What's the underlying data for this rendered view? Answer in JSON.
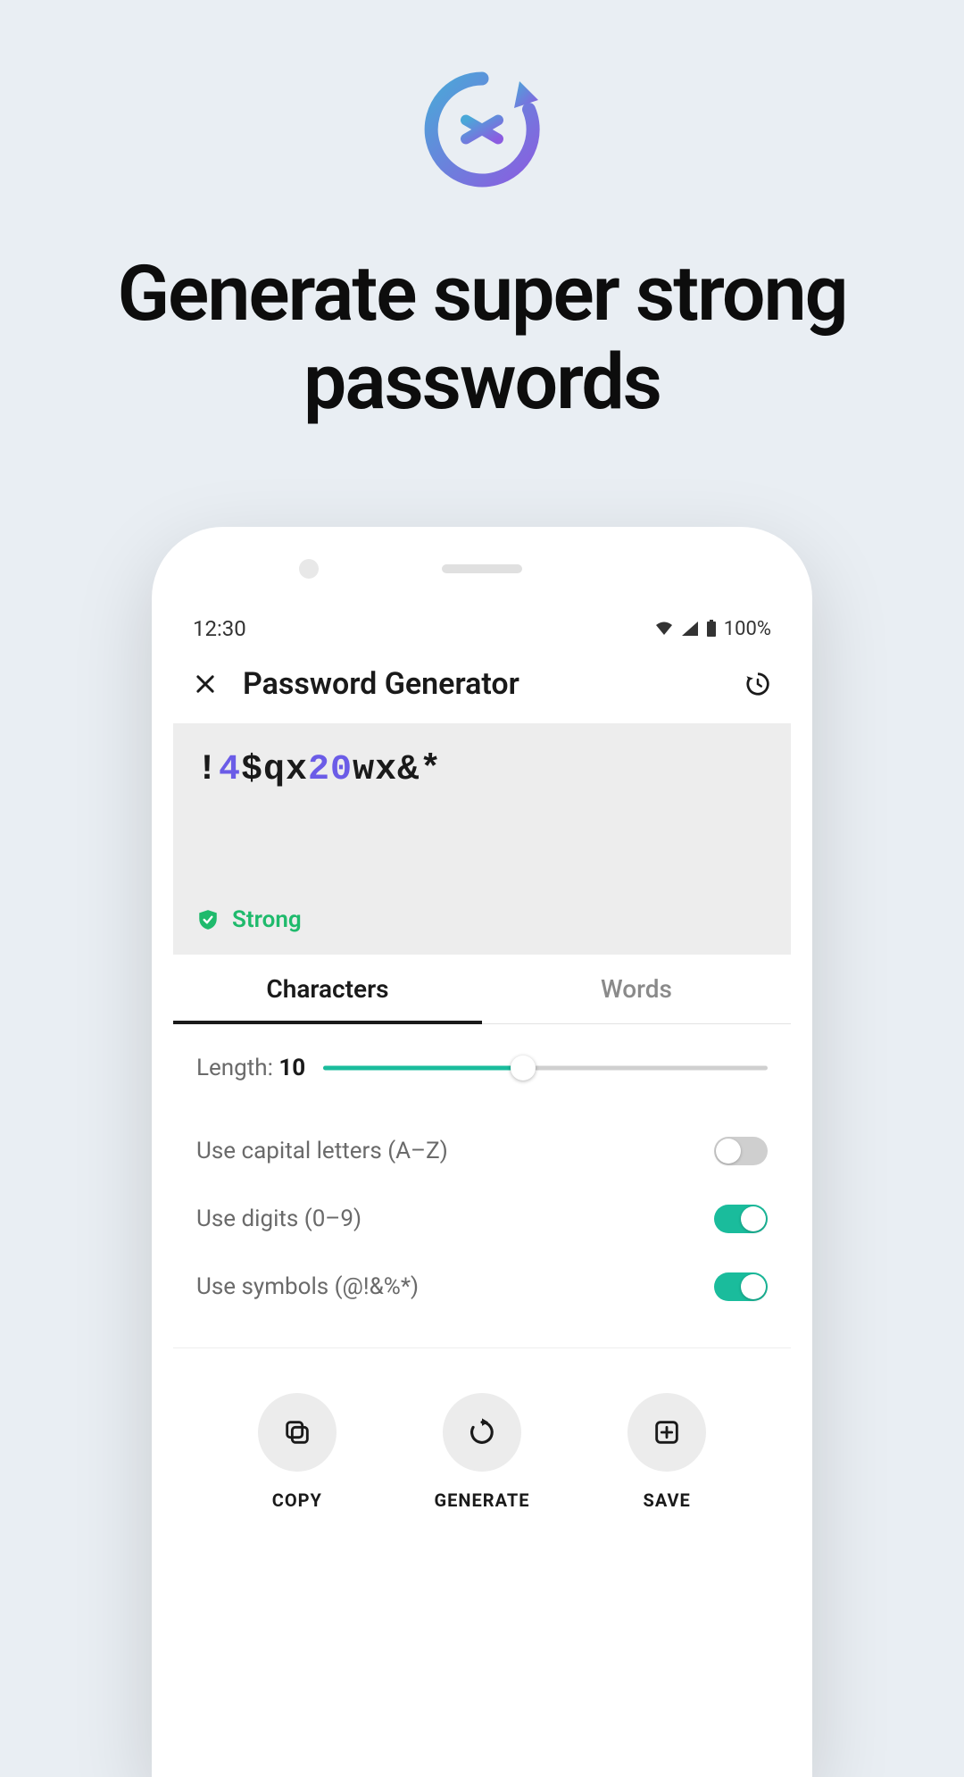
{
  "promo": {
    "headline": "Generate super strong passwords"
  },
  "status": {
    "time": "12:30",
    "battery": "100%"
  },
  "header": {
    "title": "Password Generator"
  },
  "password": {
    "segments": [
      {
        "t": "!",
        "cls": "sym"
      },
      {
        "t": "4",
        "cls": "digit"
      },
      {
        "t": "$qx",
        "cls": "sym"
      },
      {
        "t": "20",
        "cls": "digit"
      },
      {
        "t": "wx&*",
        "cls": "sym"
      }
    ],
    "strength": "Strong"
  },
  "tabs": [
    {
      "label": "Characters",
      "active": true
    },
    {
      "label": "Words",
      "active": false
    }
  ],
  "length": {
    "label": "Length: ",
    "value": "10",
    "percent": 45
  },
  "toggles": [
    {
      "label": "Use capital letters (A–Z)",
      "on": false
    },
    {
      "label": "Use digits (0–9)",
      "on": true
    },
    {
      "label": "Use symbols (@!&%*)",
      "on": true
    }
  ],
  "actions": [
    {
      "label": "COPY",
      "icon": "copy"
    },
    {
      "label": "GENERATE",
      "icon": "refresh"
    },
    {
      "label": "SAVE",
      "icon": "add"
    }
  ]
}
